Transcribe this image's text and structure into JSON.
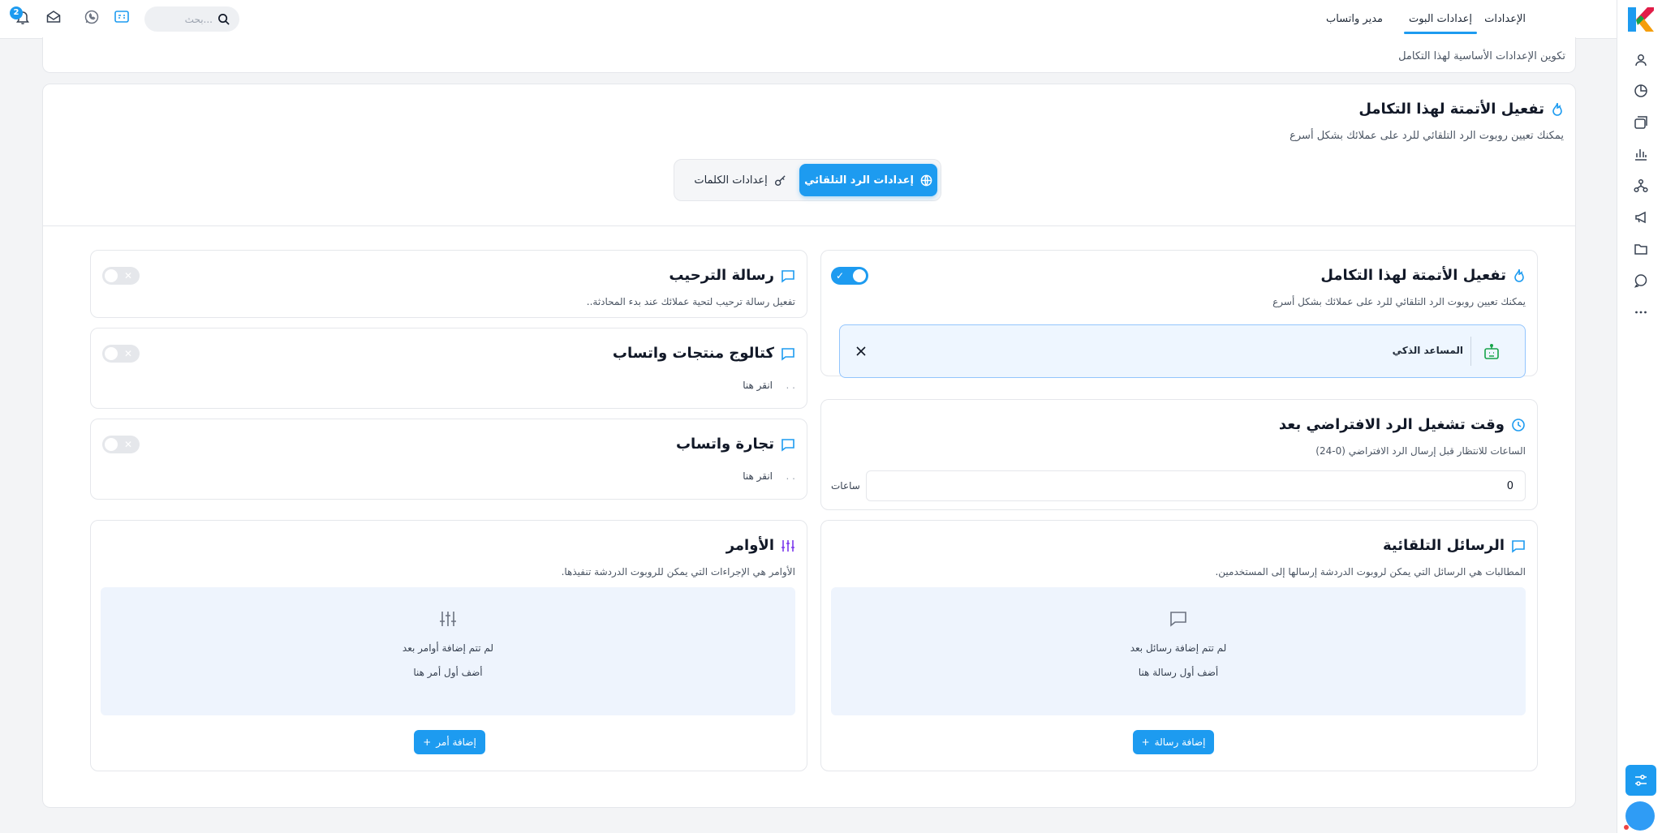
{
  "header": {
    "tabs": [
      {
        "label": "الإعدادات",
        "active": false
      },
      {
        "label": "إعدادات البوت",
        "active": true
      },
      {
        "label": "مدير واتساب",
        "active": false
      }
    ],
    "search_placeholder": "بحث...",
    "notification_count": "2"
  },
  "top_card": {
    "subtitle": "تكوين الإعدادات الأساسية لهذا التكامل"
  },
  "automation_card": {
    "title": "تفعيل الأتمتة لهذا التكامل",
    "subtitle": "يمكنك تعيين روبوت الرد التلقائي للرد على عملائك بشكل أسرع",
    "tab_auto_reply": "إعدادات الرد التلقائي",
    "tab_keywords": "إعدادات الكلمات"
  },
  "activation_panel": {
    "title": "تفعيل الأتمتة لهذا التكامل",
    "subtitle": "يمكنك تعيين روبوت الرد التلقائي للرد على عملائك بشكل أسرع",
    "enabled": true,
    "assistant_label": "المساعد الذكي"
  },
  "default_reply_panel": {
    "title": "وقت تشغيل الرد الافتراضي بعد",
    "subtitle": "الساعات للانتظار قبل إرسال الرد الافتراضي (0-24)",
    "value": "0",
    "unit": "ساعات"
  },
  "auto_messages_panel": {
    "title": "الرسائل التلقائية",
    "subtitle": "المطالبات هي الرسائل التي يمكن لروبوت الدردشة إرسالها إلى المستخدمين.",
    "empty_line1": "لم تتم إضافة رسائل بعد",
    "empty_line2": "أضف أول رسالة هنا",
    "button": "إضافة رسالة"
  },
  "welcome_panel": {
    "title": "رسالة الترحيب",
    "subtitle": "تفعيل رسالة ترحيب لتحية عملائك عند بدء المحادثة..",
    "enabled": false
  },
  "catalog_panel": {
    "title": "كتالوج منتجات واتساب",
    "hint": "انقر هنا",
    "dots": ". .",
    "enabled": false
  },
  "commerce_panel": {
    "title": "تجارة واتساب",
    "hint": "انقر هنا",
    "dots": ". .",
    "enabled": false
  },
  "commands_panel": {
    "title": "الأوامر",
    "subtitle": "الأوامر هي الإجراءات التي يمكن للروبوت الدردشة تنفيذها.",
    "empty_line1": "لم تتم إضافة أوامر بعد",
    "empty_line2": "أضف أول أمر هنا",
    "button": "إضافة أمر"
  },
  "colors": {
    "accent": "#1d9bf0",
    "empty_bg": "#eef4fd"
  }
}
